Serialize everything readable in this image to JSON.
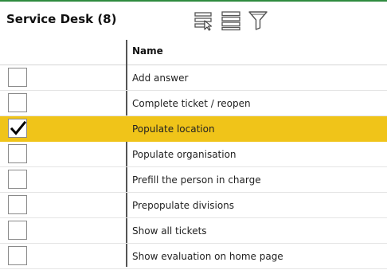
{
  "header": {
    "title": "Service Desk (8)",
    "icons": [
      "select-rows-icon",
      "list-view-icon",
      "filter-icon"
    ]
  },
  "table": {
    "columns": [
      "",
      "Name"
    ],
    "selected_row_color": "#f0c419",
    "rows": [
      {
        "label": "Add answer",
        "checked": false
      },
      {
        "label": "Complete ticket / reopen",
        "checked": false
      },
      {
        "label": "Populate location",
        "checked": true
      },
      {
        "label": "Populate organisation",
        "checked": false
      },
      {
        "label": "Prefill the person in charge",
        "checked": false
      },
      {
        "label": "Prepopulate divisions",
        "checked": false
      },
      {
        "label": "Show all tickets",
        "checked": false
      },
      {
        "label": "Show evaluation on home page",
        "checked": false
      }
    ]
  },
  "accent_color": "#2e8b3e"
}
